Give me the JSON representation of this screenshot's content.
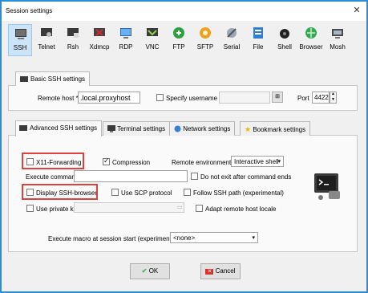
{
  "window": {
    "title": "Session settings"
  },
  "protocols": [
    {
      "label": "SSH",
      "icon": "ssh-icon"
    },
    {
      "label": "Telnet",
      "icon": "telnet-icon"
    },
    {
      "label": "Rsh",
      "icon": "rsh-icon"
    },
    {
      "label": "Xdmcp",
      "icon": "xdmcp-icon"
    },
    {
      "label": "RDP",
      "icon": "rdp-icon"
    },
    {
      "label": "VNC",
      "icon": "vnc-icon"
    },
    {
      "label": "FTP",
      "icon": "ftp-icon"
    },
    {
      "label": "SFTP",
      "icon": "sftp-icon"
    },
    {
      "label": "Serial",
      "icon": "serial-icon"
    },
    {
      "label": "File",
      "icon": "file-icon"
    },
    {
      "label": "Shell",
      "icon": "shell-icon"
    },
    {
      "label": "Browser",
      "icon": "browser-icon"
    },
    {
      "label": "Mosh",
      "icon": "mosh-icon"
    }
  ],
  "basic": {
    "tab_label": "Basic SSH settings",
    "remote_host_label": "Remote host *",
    "remote_host_value": ".local.proxyhost",
    "specify_username_label": "Specify username",
    "username_value": "",
    "port_label": "Port",
    "port_value": "4422"
  },
  "advanced_tabs": [
    {
      "label": "Advanced SSH settings"
    },
    {
      "label": "Terminal settings"
    },
    {
      "label": "Network settings"
    },
    {
      "label": "Bookmark settings"
    }
  ],
  "advanced": {
    "x11_label": "X11-Forwarding",
    "compression_label": "Compression",
    "remote_env_label": "Remote environment",
    "remote_env_value": "Interactive shell",
    "execute_command_label": "Execute command",
    "execute_command_value": "",
    "do_not_exit_label": "Do not exit after command ends",
    "display_ssh_browser_label": "Display SSH-browser",
    "use_scp_label": "Use SCP protocol",
    "follow_ssh_path_label": "Follow SSH path (experimental)",
    "use_private_key_label": "Use private key",
    "private_key_value": "",
    "adapt_locale_label": "Adapt remote host locale",
    "macro_label": "Execute macro at session start (experimental):",
    "macro_value": "<none>"
  },
  "buttons": {
    "ok": "OK",
    "cancel": "Cancel"
  },
  "colors": {
    "accent": "#2a8fd8",
    "highlight": "#e0413c"
  }
}
